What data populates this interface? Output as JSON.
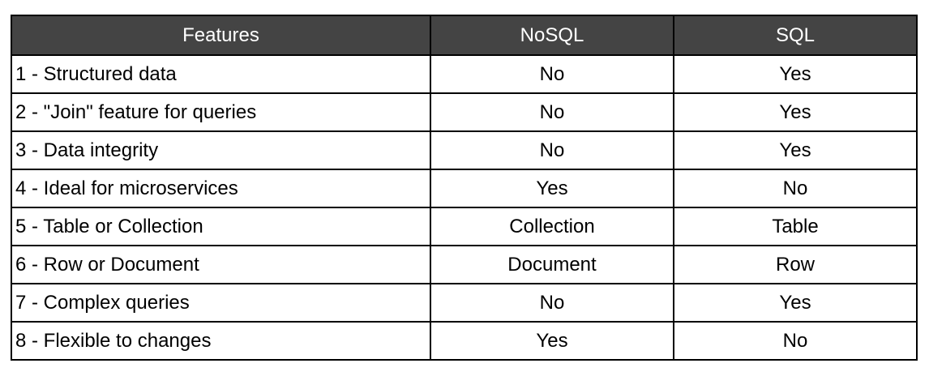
{
  "table": {
    "headers": [
      "Features",
      "NoSQL",
      "SQL"
    ],
    "rows": [
      {
        "feature": "1 - Structured data",
        "nosql": "No",
        "sql": "Yes"
      },
      {
        "feature": "2 - \"Join\" feature for queries",
        "nosql": "No",
        "sql": "Yes"
      },
      {
        "feature": "3 - Data integrity",
        "nosql": "No",
        "sql": "Yes"
      },
      {
        "feature": "4 - Ideal for microservices",
        "nosql": "Yes",
        "sql": "No"
      },
      {
        "feature": "5 - Table or Collection",
        "nosql": "Collection",
        "sql": "Table"
      },
      {
        "feature": "6 - Row or Document",
        "nosql": "Document",
        "sql": "Row"
      },
      {
        "feature": "7 - Complex queries",
        "nosql": "No",
        "sql": "Yes"
      },
      {
        "feature": "8 - Flexible to changes",
        "nosql": "Yes",
        "sql": "No"
      }
    ]
  },
  "colors": {
    "header_bg": "#444444",
    "header_text": "#ffffff",
    "border": "#000000"
  }
}
